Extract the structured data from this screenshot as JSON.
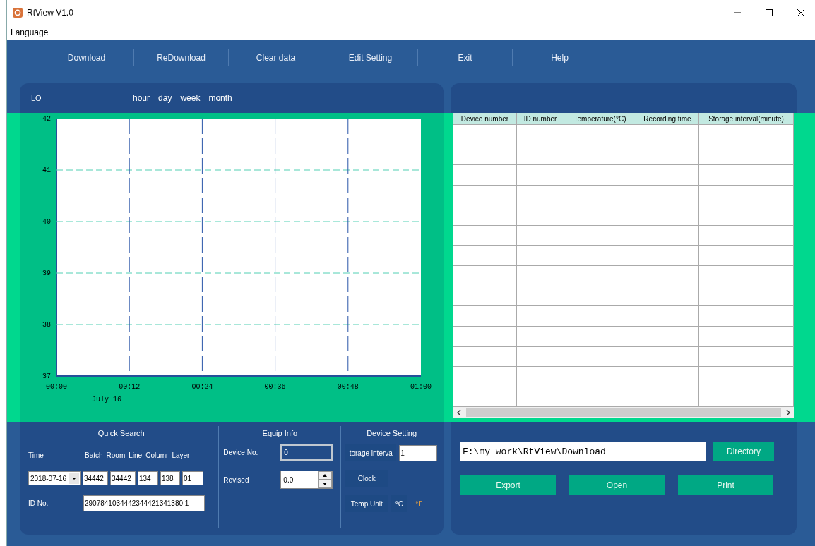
{
  "window": {
    "title": "RtView V1.0"
  },
  "menu": [
    "Language"
  ],
  "toolbar": [
    "Download",
    "ReDownload",
    "Clear data",
    "Edit Setting",
    "Exit",
    "Help"
  ],
  "chart_panel": {
    "series_label": "LO",
    "ranges": [
      "hour",
      "day",
      "week",
      "month"
    ],
    "chart_data": {
      "type": "line",
      "grid": true,
      "xlabel": "July 16",
      "xlim": [
        0,
        60
      ],
      "ylim": [
        37,
        42
      ],
      "xticks": [
        {
          "value": 0,
          "label": "00:00"
        },
        {
          "value": 12,
          "label": "00:12"
        },
        {
          "value": 24,
          "label": "00:24"
        },
        {
          "value": 36,
          "label": "00:36"
        },
        {
          "value": 48,
          "label": "00:48"
        },
        {
          "value": 60,
          "label": "01:00"
        }
      ],
      "yticks": [
        37,
        38,
        39,
        40,
        41,
        42
      ]
    }
  },
  "table": {
    "columns": [
      "Device number",
      "ID number",
      "Temperature(°C)",
      "Recording time",
      "Storage interval(minute)"
    ]
  },
  "quick_search": {
    "title": "Quick Search",
    "time_label": "Time",
    "date": "2018-07-16",
    "fields": [
      {
        "label": "Batch",
        "value": "34442"
      },
      {
        "label": "Room",
        "value": "34442"
      },
      {
        "label": "Line",
        "value": "134"
      },
      {
        "label": "Columr",
        "value": "138"
      },
      {
        "label": "Layer",
        "value": "01"
      }
    ],
    "id_label": "ID No.",
    "id_value": "2907841034442344421341380 1"
  },
  "equip_info": {
    "title": "Equip Info",
    "device_label": "Device No.",
    "device_value": "0",
    "revised_label": "Revised",
    "revised_value": "0.0"
  },
  "device_setting": {
    "title": "Device Setting",
    "interval_button": "torage interva",
    "interval_value": "1",
    "clock_button": "Clock",
    "unit_button": "Temp Unit",
    "units": [
      {
        "label": "°C",
        "selected": true
      },
      {
        "label": "°F",
        "selected": false
      }
    ]
  },
  "export_panel": {
    "path": "F:\\my work\\RtView\\Download",
    "directory_button": "Directory",
    "buttons": [
      "Export",
      "Open",
      "Print"
    ]
  }
}
